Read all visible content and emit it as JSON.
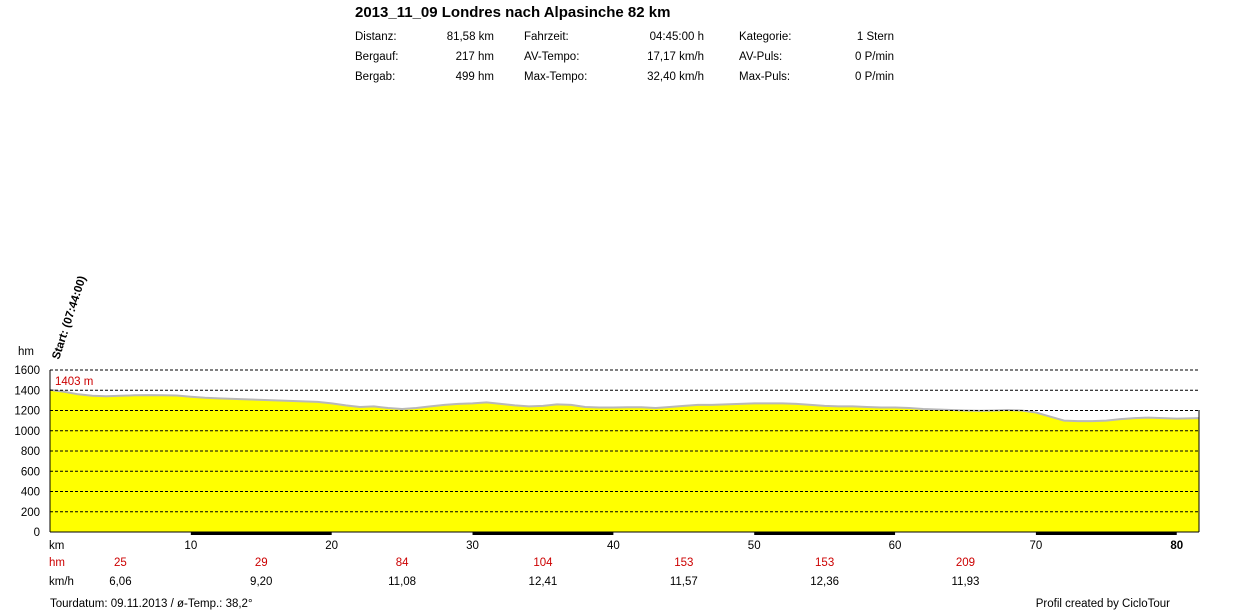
{
  "title": "2013_11_09 Londres nach Alpasinche 82 km",
  "stats": {
    "col1": [
      {
        "label": "Distanz:",
        "value": "81,58 km"
      },
      {
        "label": "Bergauf:",
        "value": "217 hm"
      },
      {
        "label": "Bergab:",
        "value": "499 hm"
      }
    ],
    "col2": [
      {
        "label": "Fahrzeit:",
        "value": "04:45:00 h"
      },
      {
        "label": "AV-Tempo:",
        "value": "17,17 km/h"
      },
      {
        "label": "Max-Tempo:",
        "value": "32,40 km/h"
      }
    ],
    "col3": [
      {
        "label": "Kategorie:",
        "value": "1 Stern"
      },
      {
        "label": "AV-Puls:",
        "value": "0 P/min"
      },
      {
        "label": "Max-Puls:",
        "value": "0 P/min"
      }
    ]
  },
  "start_label": "Start: (07:44:00)",
  "row_labels": {
    "km": "km",
    "hm": "hm",
    "kmh": "km/h"
  },
  "segment_hm": [
    "25",
    "29",
    "84",
    "104",
    "153",
    "153",
    "209"
  ],
  "segment_kmh": [
    "6,06",
    "9,20",
    "11,08",
    "12,41",
    "11,57",
    "12,36",
    "11,93"
  ],
  "footer": {
    "left": "Tourdatum: 09.11.2013  /  ø-Temp.: 38,2°",
    "right": "Profil created by CicloTour"
  },
  "colors": {
    "fill": "#ffff00",
    "profile_line": "#b8b8b8",
    "red_text": "#cc0000"
  },
  "chart_data": {
    "type": "area",
    "title": "",
    "xlabel": "km",
    "ylabel": "hm",
    "xlim": [
      0,
      81.58
    ],
    "ylim": [
      0,
      1600
    ],
    "y_ticks": [
      0,
      200,
      400,
      600,
      800,
      1000,
      1200,
      1400,
      1600
    ],
    "x_ticks": [
      10,
      20,
      30,
      40,
      50,
      60,
      70,
      80
    ],
    "x_tick_labels": [
      "10",
      "20",
      "30",
      "40",
      "50",
      "60",
      "70",
      "80"
    ],
    "max_annotation": "1403 m",
    "grid": true,
    "series": [
      {
        "x": [
          0,
          1,
          2,
          3,
          4,
          5,
          6,
          7,
          8,
          9,
          10,
          11,
          12,
          13,
          14,
          15,
          16,
          17,
          18,
          19,
          20,
          21,
          22,
          23,
          24,
          25,
          26,
          27,
          28,
          29,
          30,
          31,
          32,
          33,
          34,
          35,
          36,
          37,
          38,
          39,
          40,
          41,
          42,
          43,
          44,
          45,
          46,
          47,
          48,
          49,
          50,
          51,
          52,
          53,
          54,
          55,
          56,
          57,
          58,
          59,
          60,
          61,
          62,
          63,
          64,
          65,
          66,
          67,
          68,
          69,
          70,
          71,
          72,
          73,
          74,
          75,
          76,
          77,
          78,
          79,
          80,
          81.58
        ],
        "y": [
          1403,
          1385,
          1360,
          1345,
          1340,
          1345,
          1350,
          1352,
          1350,
          1348,
          1335,
          1325,
          1320,
          1315,
          1310,
          1305,
          1300,
          1295,
          1290,
          1285,
          1270,
          1250,
          1235,
          1240,
          1225,
          1215,
          1225,
          1240,
          1255,
          1265,
          1270,
          1280,
          1265,
          1250,
          1240,
          1245,
          1260,
          1255,
          1235,
          1230,
          1230,
          1232,
          1232,
          1225,
          1235,
          1245,
          1255,
          1255,
          1260,
          1265,
          1270,
          1270,
          1270,
          1265,
          1255,
          1245,
          1240,
          1240,
          1235,
          1230,
          1230,
          1225,
          1215,
          1210,
          1205,
          1200,
          1198,
          1200,
          1205,
          1200,
          1180,
          1140,
          1100,
          1095,
          1095,
          1100,
          1115,
          1125,
          1130,
          1125,
          1120,
          1125
        ]
      }
    ]
  }
}
